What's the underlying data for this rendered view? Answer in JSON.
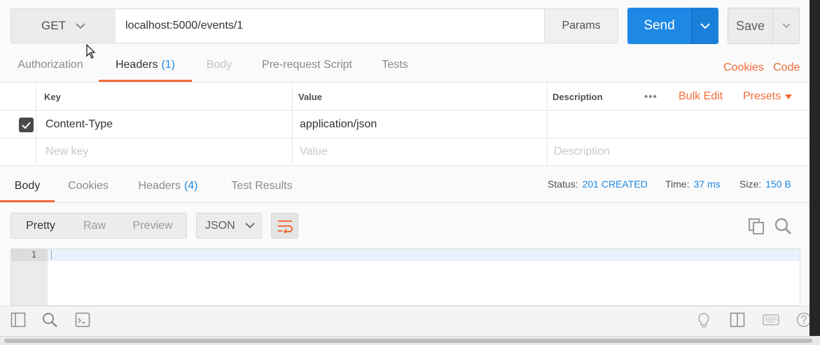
{
  "request": {
    "method": "GET",
    "url": "localhost:5000/events/1",
    "params_label": "Params",
    "send_label": "Send",
    "save_label": "Save"
  },
  "request_tabs": [
    {
      "label": "Authorization"
    },
    {
      "label": "Headers",
      "count": "(1)"
    },
    {
      "label": "Body"
    },
    {
      "label": "Pre-request Script"
    },
    {
      "label": "Tests"
    }
  ],
  "request_links": {
    "cookies": "Cookies",
    "code": "Code"
  },
  "headers_table": {
    "columns": {
      "key": "Key",
      "value": "Value",
      "description": "Description"
    },
    "more": "•••",
    "bulk_edit": "Bulk Edit",
    "presets": "Presets",
    "rows": [
      {
        "checked": true,
        "key": "Content-Type",
        "value": "application/json",
        "description": ""
      }
    ],
    "placeholders": {
      "key": "New key",
      "value": "Value",
      "description": "Description"
    }
  },
  "response_tabs": [
    {
      "label": "Body"
    },
    {
      "label": "Cookies"
    },
    {
      "label": "Headers",
      "count": "(4)"
    },
    {
      "label": "Test Results"
    }
  ],
  "response_meta": {
    "status_label": "Status:",
    "status_value": "201 CREATED",
    "time_label": "Time:",
    "time_value": "37 ms",
    "size_label": "Size:",
    "size_value": "150 B"
  },
  "view_modes": [
    {
      "label": "Pretty"
    },
    {
      "label": "Raw"
    },
    {
      "label": "Preview"
    }
  ],
  "format": "JSON",
  "editor": {
    "line_number": "1"
  },
  "colors": {
    "accent_blue": "#1e88e5",
    "accent_orange": "#f26b3a"
  },
  "statusbar_icons": [
    "sidebar-icon",
    "search-icon",
    "console-icon",
    "lightbulb-icon",
    "two-pane-icon",
    "keyboard-icon",
    "help-icon"
  ]
}
